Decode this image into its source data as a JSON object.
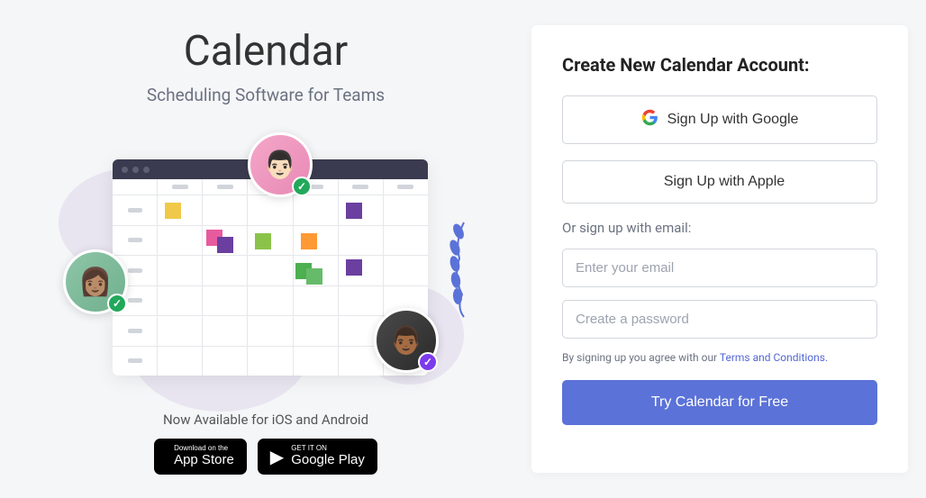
{
  "hero": {
    "title": "Calendar",
    "subtitle": "Scheduling Software for Teams",
    "availability": "Now Available for iOS and Android"
  },
  "stores": {
    "apple": {
      "small": "Download on the",
      "big": "App Store"
    },
    "google": {
      "small": "GET IT ON",
      "big": "Google Play"
    }
  },
  "signup": {
    "title": "Create New Calendar Account:",
    "google_btn": "Sign Up with Google",
    "apple_btn": "Sign Up with Apple",
    "email_divider": "Or sign up with email:",
    "email_placeholder": "Enter your email",
    "password_placeholder": "Create a password",
    "terms_prefix": "By signing up you agree with our ",
    "terms_link": "Terms and Conditions.",
    "cta": "Try Calendar for Free"
  }
}
